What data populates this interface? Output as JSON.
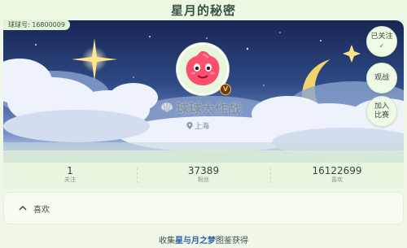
{
  "header": {
    "title": "星月的秘密"
  },
  "profile": {
    "id_label": "球球号: 16800009",
    "level": "V",
    "game_title": "球球大作战",
    "location": "上海"
  },
  "actions": {
    "follow": {
      "line1": "已关注",
      "line2": "✓"
    },
    "watch": "观战",
    "join": {
      "line1": "加入",
      "line2": "比赛"
    }
  },
  "stats": [
    {
      "value": "1",
      "label": "关注"
    },
    {
      "value": "37389",
      "label": "粉丝"
    },
    {
      "value": "16122699",
      "label": "喜欢"
    }
  ],
  "likes": {
    "label": "喜欢"
  },
  "footer": {
    "prefix": "收集",
    "highlight": "星与月之梦",
    "suffix": "图鉴获得"
  },
  "colors": {
    "background": "#eef7e8",
    "banner_sky": "#1c2c57",
    "moon": "#f0d46a",
    "highlight": "#2f5fa3"
  },
  "icons": [
    "avatar-blob-icon",
    "shell-icon",
    "location-pin-icon",
    "chevron-up-icon",
    "check-icon",
    "star-icon",
    "moon-icon"
  ]
}
